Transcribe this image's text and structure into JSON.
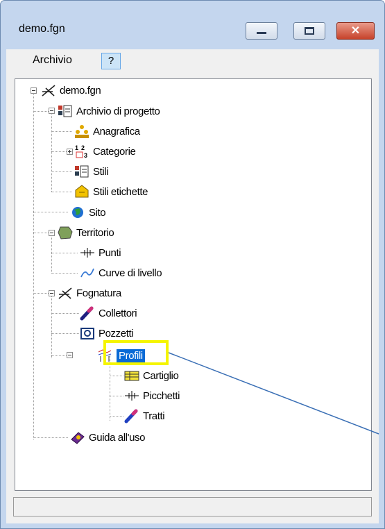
{
  "window": {
    "title": "demo.fgn",
    "close_glyph": "✕"
  },
  "menu": {
    "archivio": "Archivio",
    "help": "?"
  },
  "tree": {
    "root": "demo.fgn",
    "archivio_progetto": "Archivio di progetto",
    "anagrafica": "Anagrafica",
    "categorie": "Categorie",
    "stili": "Stili",
    "stili_etichette": "Stili etichette",
    "sito": "Sito",
    "territorio": "Territorio",
    "punti": "Punti",
    "curve": "Curve di livello",
    "fognatura": "Fognatura",
    "collettori": "Collettori",
    "pozzetti": "Pozzetti",
    "profili": "Profili",
    "cartiglio": "Cartiglio",
    "picchetti": "Picchetti",
    "tratti": "Tratti",
    "guida": "Guida all'uso"
  },
  "status": {
    "text": ""
  },
  "colors": {
    "selection": "#0a6ad6",
    "highlight": "#f5f500",
    "callout": "#3a6fb5"
  }
}
